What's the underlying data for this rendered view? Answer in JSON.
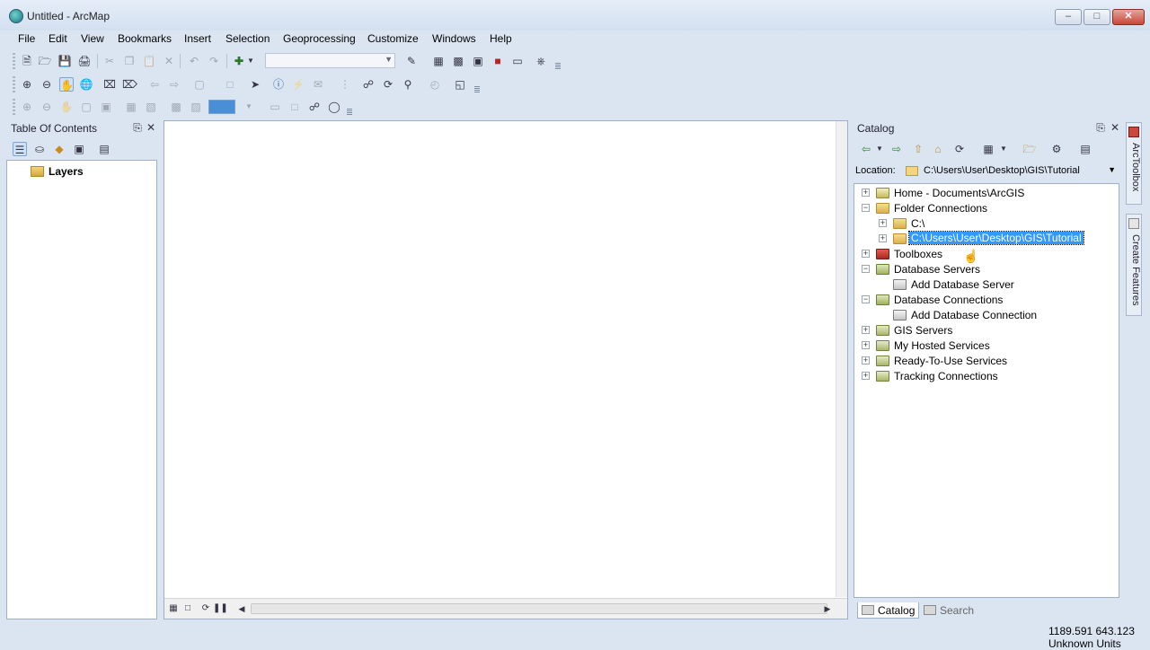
{
  "window": {
    "title": "Untitled - ArcMap"
  },
  "menu": [
    "File",
    "Edit",
    "View",
    "Bookmarks",
    "Insert",
    "Selection",
    "Geoprocessing",
    "Customize",
    "Windows",
    "Help"
  ],
  "toc": {
    "title": "Table Of Contents",
    "layers_label": "Layers"
  },
  "catalog": {
    "title": "Catalog",
    "location_label": "Location:",
    "location_value": "C:\\Users\\User\\Desktop\\GIS\\Tutorial",
    "tree": [
      {
        "label": "Home - Documents\\ArcGIS",
        "expander": "+",
        "icon": "home-folder-icon"
      },
      {
        "label": "Folder Connections",
        "expander": "−",
        "icon": "folder-connections-icon"
      },
      {
        "label": "C:\\",
        "expander": "+",
        "icon": "folder-icon"
      },
      {
        "label": "C:\\Users\\User\\Desktop\\GIS\\Tutorial",
        "expander": "+",
        "icon": "folder-icon",
        "selected": true
      },
      {
        "label": "Toolboxes",
        "expander": "+",
        "icon": "toolbox-icon"
      },
      {
        "label": "Database Servers",
        "expander": "−",
        "icon": "database-servers-icon"
      },
      {
        "label": "Add Database Server",
        "expander": "",
        "icon": "add-database-server-icon"
      },
      {
        "label": "Database Connections",
        "expander": "−",
        "icon": "database-connections-icon"
      },
      {
        "label": "Add Database Connection",
        "expander": "",
        "icon": "add-database-connection-icon"
      },
      {
        "label": "GIS Servers",
        "expander": "+",
        "icon": "gis-servers-icon"
      },
      {
        "label": "My Hosted Services",
        "expander": "+",
        "icon": "hosted-services-icon"
      },
      {
        "label": "Ready-To-Use Services",
        "expander": "+",
        "icon": "ready-to-use-services-icon"
      },
      {
        "label": "Tracking Connections",
        "expander": "+",
        "icon": "tracking-connections-icon"
      }
    ],
    "tabs": [
      "Catalog",
      "Search"
    ]
  },
  "side_tabs": [
    "ArcToolbox",
    "Create Features"
  ],
  "status": {
    "coordinates": "1189.591  643.123 Unknown Units"
  }
}
